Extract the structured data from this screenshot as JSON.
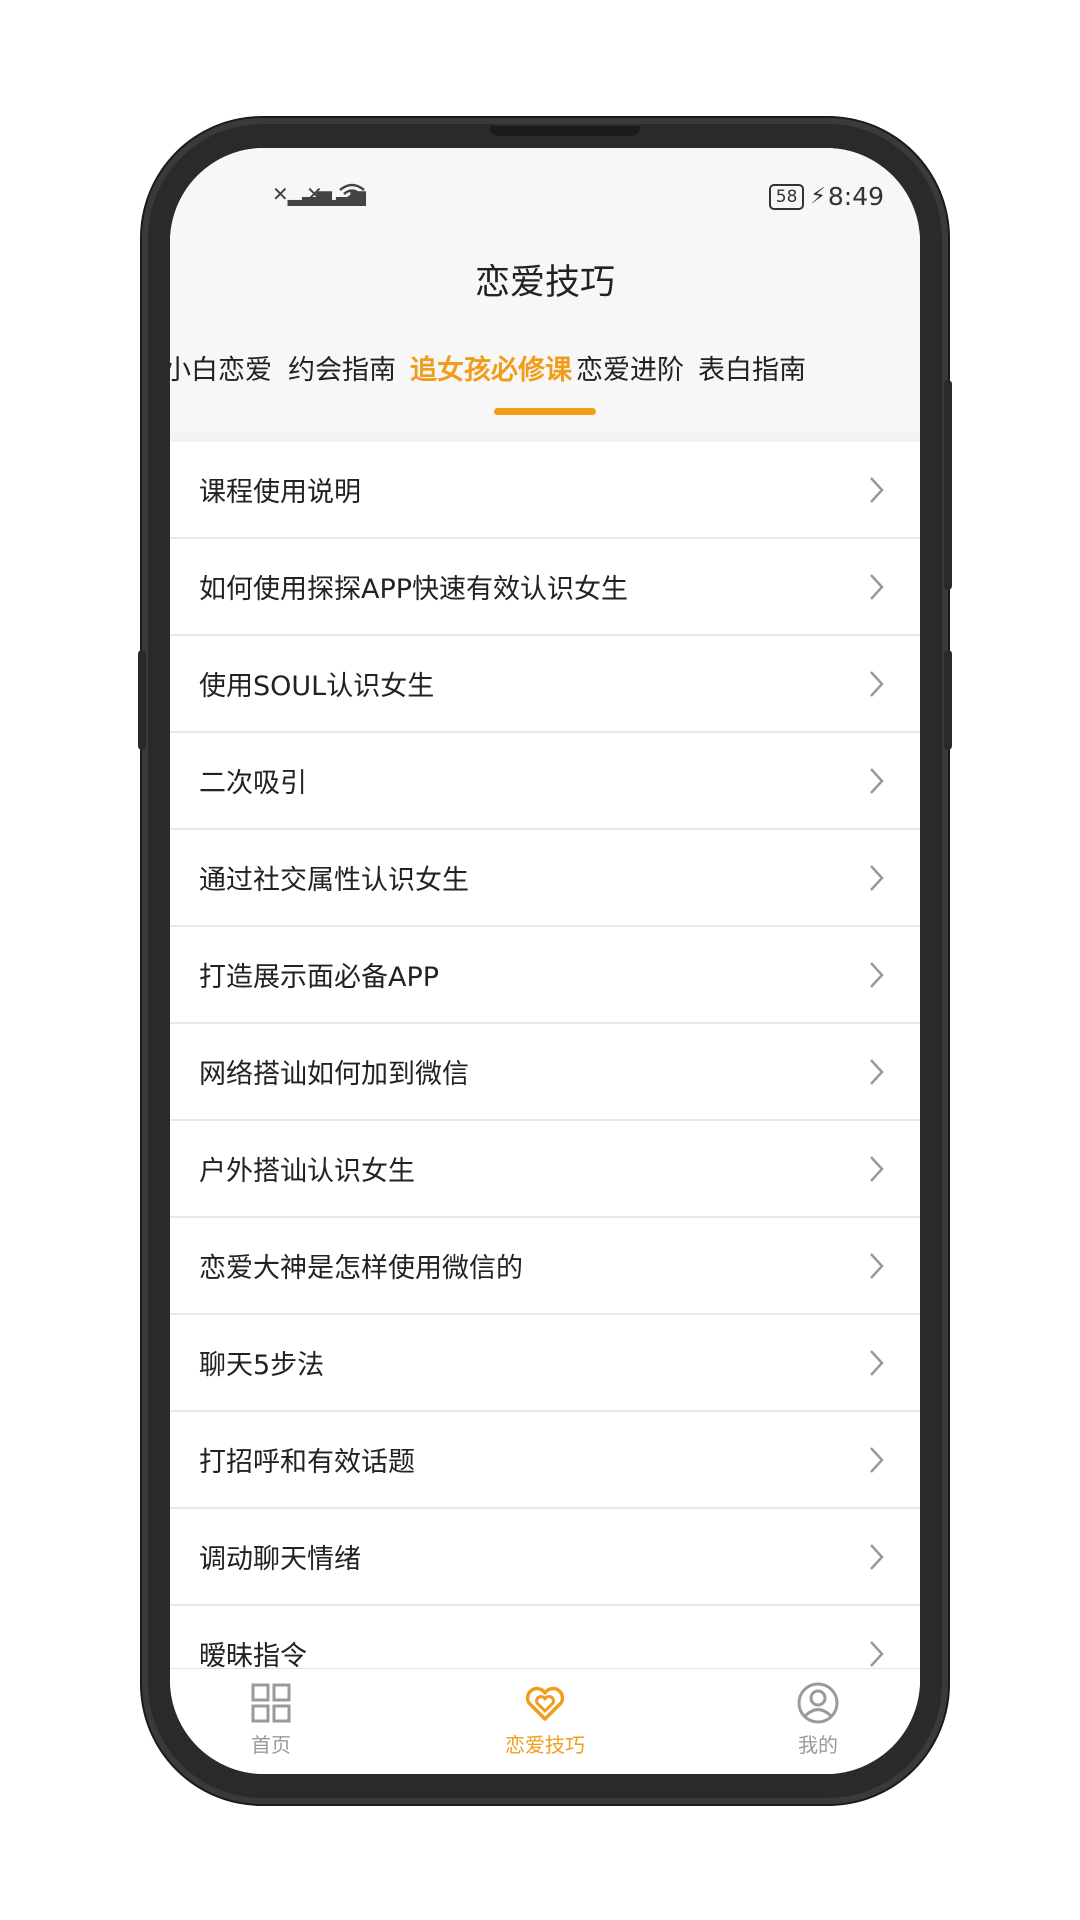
{
  "status": {
    "time": "8:49",
    "battery": "58"
  },
  "header": {
    "title": "恋爱技巧"
  },
  "tabs": [
    {
      "label": "小白恋爱"
    },
    {
      "label": "约会指南"
    },
    {
      "label": "追女孩必修课"
    },
    {
      "label": "恋爱进阶"
    },
    {
      "label": "表白指南"
    }
  ],
  "active_tab": "追女孩必修课",
  "list": [
    {
      "label": "课程使用说明"
    },
    {
      "label": "如何使用探探APP快速有效认识女生"
    },
    {
      "label": "使用SOUL认识女生"
    },
    {
      "label": "二次吸引"
    },
    {
      "label": "通过社交属性认识女生"
    },
    {
      "label": "打造展示面必备APP"
    },
    {
      "label": "网络搭讪如何加到微信"
    },
    {
      "label": "户外搭讪认识女生"
    },
    {
      "label": "恋爱大神是怎样使用微信的"
    },
    {
      "label": "聊天5步法"
    },
    {
      "label": "打招呼和有效话题"
    },
    {
      "label": "调动聊天情绪"
    },
    {
      "label": "暧昧指令"
    }
  ],
  "tabbar": {
    "home": {
      "label": "首页",
      "icon": "grid-icon"
    },
    "tips": {
      "label": "恋爱技巧",
      "icon": "heart-icon"
    },
    "mine": {
      "label": "我的",
      "icon": "user-icon"
    }
  },
  "colors": {
    "accent": "#f19d1c",
    "text": "#222222",
    "muted": "#9a9a9a"
  }
}
